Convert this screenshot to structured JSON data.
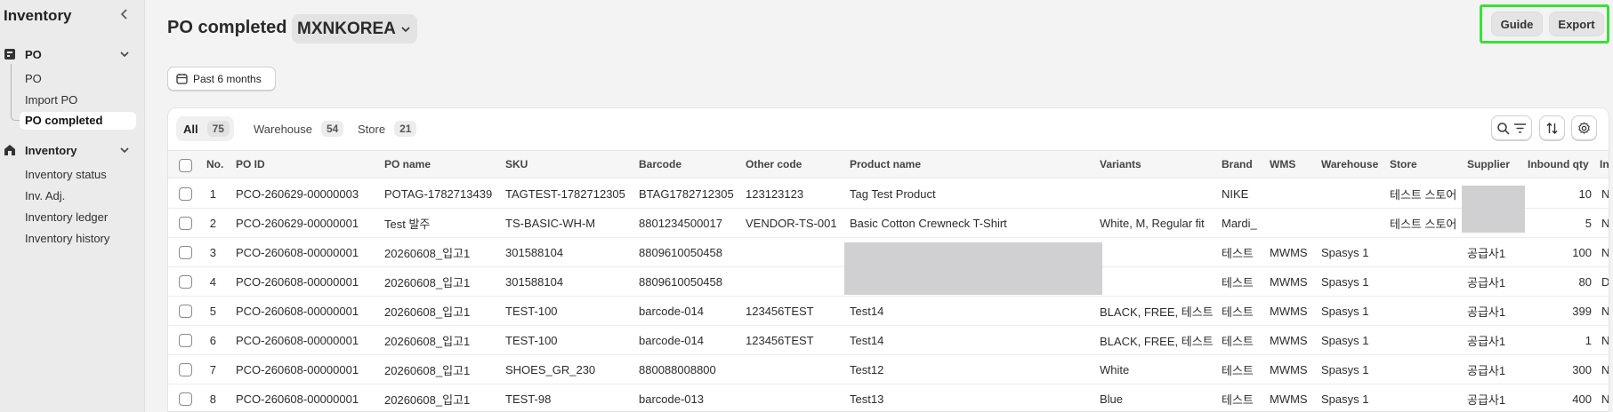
{
  "sidebar": {
    "title": "Inventory",
    "groups": [
      {
        "label": "PO",
        "items": [
          "PO",
          "Import PO",
          "PO completed"
        ],
        "active": "PO completed"
      },
      {
        "label": "Inventory",
        "items": [
          "Inventory status",
          "Inv. Adj.",
          "Inventory ledger",
          "Inventory history"
        ]
      }
    ]
  },
  "header": {
    "title": "PO completed",
    "store": "MXNKOREA",
    "guide_label": "Guide",
    "export_label": "Export"
  },
  "filter": {
    "date_range": "Past 6 months"
  },
  "tabs": [
    {
      "label": "All",
      "count": "75",
      "active": true
    },
    {
      "label": "Warehouse",
      "count": "54"
    },
    {
      "label": "Store",
      "count": "21"
    }
  ],
  "table": {
    "columns": [
      "No.",
      "PO ID",
      "PO name",
      "SKU",
      "Barcode",
      "Other code",
      "Product name",
      "Variants",
      "Brand",
      "WMS",
      "Warehouse",
      "Store",
      "Supplier",
      "Inbound qty",
      "In"
    ],
    "rows": [
      [
        "1",
        "PCO-260629-00000003",
        "POTAG-1782713439",
        "TAGTEST-1782712305",
        "BTAG1782712305",
        "123123123",
        "Tag Test Product",
        "",
        "NIKE",
        "",
        "",
        "테스트 스토어",
        "",
        "10",
        "N"
      ],
      [
        "2",
        "PCO-260629-00000001",
        "Test 발주",
        "TS-BASIC-WH-M",
        "8801234500017",
        "VENDOR-TS-001",
        "Basic Cotton Crewneck T-Shirt",
        "White, M, Regular fit",
        "Mardi_",
        "",
        "",
        "테스트 스토어",
        "",
        "5",
        "N"
      ],
      [
        "3",
        "PCO-260608-00000001",
        "20260608_입고1",
        "301588104",
        "8809610050458",
        "",
        "",
        "",
        "테스트",
        "MWMS",
        "Spasys 1",
        "",
        "공급사1",
        "100",
        "N"
      ],
      [
        "4",
        "PCO-260608-00000001",
        "20260608_입고1",
        "301588104",
        "8809610050458",
        "",
        "",
        "",
        "테스트",
        "MWMS",
        "Spasys 1",
        "",
        "공급사1",
        "80",
        "D"
      ],
      [
        "5",
        "PCO-260608-00000001",
        "20260608_입고1",
        "TEST-100",
        "barcode-014",
        "123456TEST",
        "Test14",
        "BLACK, FREE, 테스트",
        "테스트",
        "MWMS",
        "Spasys 1",
        "",
        "공급사1",
        "399",
        "N"
      ],
      [
        "6",
        "PCO-260608-00000001",
        "20260608_입고1",
        "TEST-100",
        "barcode-014",
        "123456TEST",
        "Test14",
        "BLACK, FREE, 테스트",
        "테스트",
        "MWMS",
        "Spasys 1",
        "",
        "공급사1",
        "1",
        "N"
      ],
      [
        "7",
        "PCO-260608-00000001",
        "20260608_입고1",
        "SHOES_GR_230",
        "880088008800",
        "",
        "Test12",
        "White",
        "테스트",
        "MWMS",
        "Spasys 1",
        "",
        "공급사1",
        "300",
        "N"
      ],
      [
        "8",
        "PCO-260608-00000001",
        "20260608_입고1",
        "TEST-98",
        "barcode-013",
        "",
        "Test13",
        "Blue",
        "테스트",
        "MWMS",
        "Spasys 1",
        "",
        "공급사1",
        "400",
        "N"
      ]
    ]
  },
  "icons": [
    "chevron-left-icon",
    "box-icon",
    "warehouse-icon",
    "chevron-down-icon",
    "calendar-icon",
    "search-icon",
    "filter-icon",
    "sort-icon",
    "gear-icon"
  ],
  "colors": {
    "highlight": "#39e039",
    "background": "#f3f3f3",
    "sidebar": "#ebebeb"
  }
}
